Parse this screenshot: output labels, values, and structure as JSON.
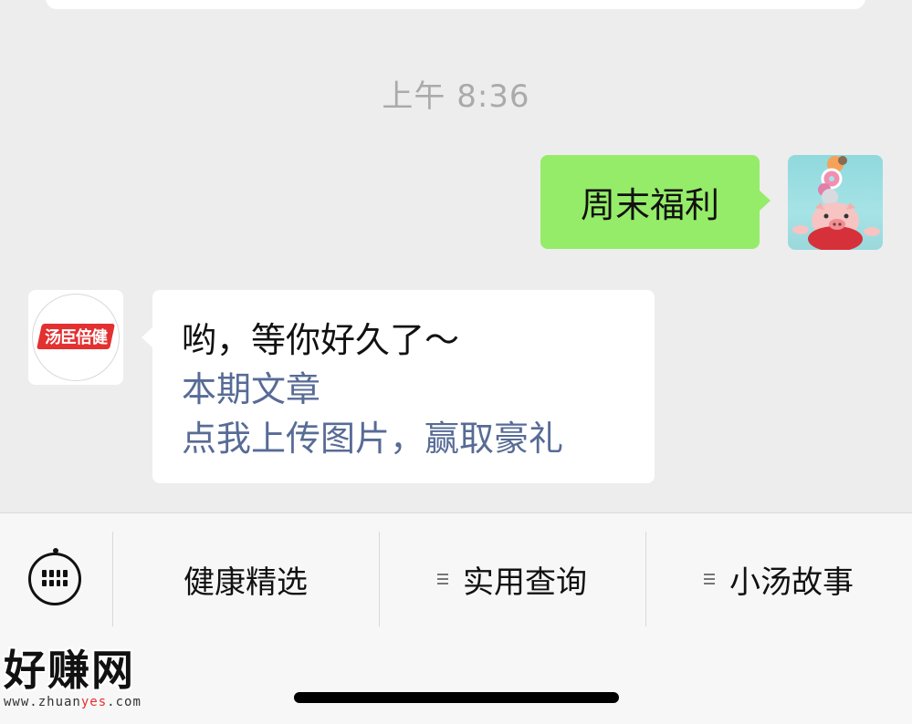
{
  "chat": {
    "timestamp": "上午 8:36",
    "outgoing": {
      "text": "周末福利"
    },
    "incoming": {
      "avatar_logo_text": "汤臣倍健",
      "line1": "哟，等你好久了～",
      "link1": "本期文章",
      "link2": "点我上传图片，赢取豪礼"
    }
  },
  "menu": {
    "keyboard_icon": "keyboard-icon",
    "items": [
      {
        "label": "健康精选",
        "has_submenu": false
      },
      {
        "label": "实用查询",
        "has_submenu": true
      },
      {
        "label": "小汤故事",
        "has_submenu": true
      }
    ]
  },
  "watermark": {
    "brand": "好赚网",
    "url_prefix": "www.zhuan",
    "url_highlight": "yes",
    "url_suffix": ".com"
  },
  "colors": {
    "background": "#ededed",
    "outgoing_bubble": "#95ec69",
    "link": "#576b95",
    "brand_red": "#e33030"
  }
}
